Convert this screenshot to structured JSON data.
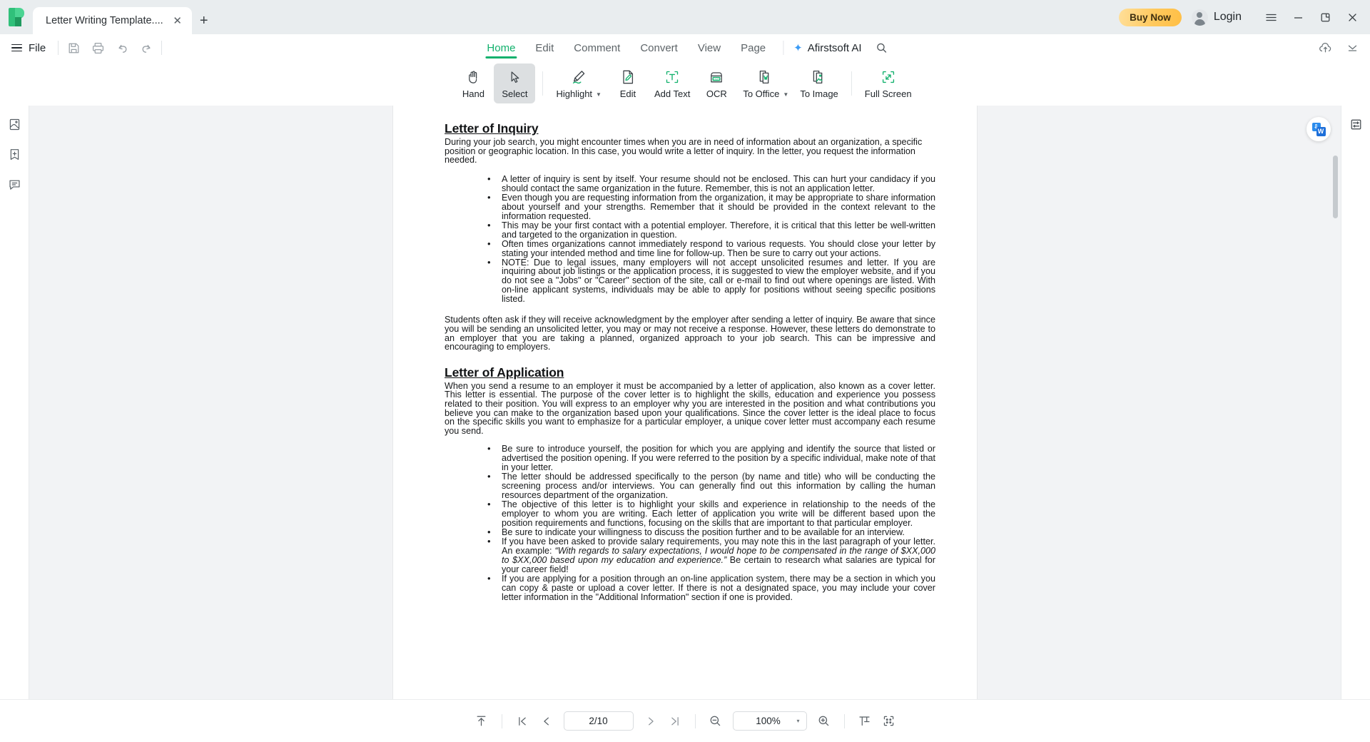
{
  "titlebar": {
    "tab_title": "Letter Writing Template....",
    "close_tab_label": "✕",
    "new_tab_label": "+",
    "buy_now_label": "Buy Now",
    "login_label": "Login",
    "minimize_label": "—",
    "restore_label": "❐",
    "close_label": "✕"
  },
  "menu": {
    "file_label": "File",
    "tabs": [
      {
        "label": "Home",
        "active": true
      },
      {
        "label": "Edit",
        "active": false
      },
      {
        "label": "Comment",
        "active": false
      },
      {
        "label": "Convert",
        "active": false
      },
      {
        "label": "View",
        "active": false
      },
      {
        "label": "Page",
        "active": false
      }
    ],
    "ai_label": "Afirstsoft AI"
  },
  "toolbar": {
    "tools": [
      {
        "label": "Hand",
        "icon": "hand-icon",
        "selected": false,
        "caret": false
      },
      {
        "label": "Select",
        "icon": "cursor-icon",
        "selected": true,
        "caret": false
      },
      {
        "label": "Highlight",
        "icon": "highlight-pen-icon",
        "selected": false,
        "caret": true
      },
      {
        "label": "Edit",
        "icon": "edit-document-icon",
        "selected": false,
        "caret": false
      },
      {
        "label": "Add Text",
        "icon": "add-text-icon",
        "selected": false,
        "caret": false
      },
      {
        "label": "OCR",
        "icon": "ocr-icon",
        "selected": false,
        "caret": false
      },
      {
        "label": "To Office",
        "icon": "to-office-word-icon",
        "selected": false,
        "caret": true
      },
      {
        "label": "To Image",
        "icon": "to-image-icon",
        "selected": false,
        "caret": false
      },
      {
        "label": "Full Screen",
        "icon": "full-screen-icon",
        "selected": false,
        "caret": false
      }
    ]
  },
  "bottombar": {
    "page_value": "2/10",
    "zoom_value": "100%",
    "zoom_caret": "▾"
  },
  "document": {
    "section1_title": "Letter of Inquiry",
    "section1_intro": "During your job search, you might encounter times when you are in need of information about an organization, a specific position or geographic location.  In this case, you would write a letter of inquiry.  In the letter, you request the information needed.",
    "section1_bullets": [
      "A letter of inquiry is sent by itself.  Your resume should not be enclosed.  This can hurt your candidacy if you should contact the same organization in the future. Remember, this is not an application letter.",
      "Even though you are requesting information from the organization, it may be appropriate to share information about yourself and your strengths.  Remember that it should be provided in the context relevant to the information requested.",
      "This may be your first contact with a potential employer.  Therefore, it is critical that this letter be well-written and targeted to the organization in question.",
      "Often times organizations cannot immediately respond to various requests.  You should close your letter by stating your intended method and time line for follow-up.  Then be sure to carry out your actions.",
      "NOTE: Due to legal issues, many employers will not accept unsolicited resumes and letter. If you are inquiring about job listings or the application process, it is suggested to view the employer website, and if you do not see a \"Jobs\" or \"Career\" section of the site, call or e-mail to find out where openings are listed. With on-line applicant systems, individuals may be able to apply for positions without seeing specific positions listed."
    ],
    "section1_closing": "Students often ask if they will receive acknowledgment by the employer after sending a letter of inquiry.  Be aware that since you will be sending an unsolicited letter, you may or may not receive a response.  However, these letters do demonstrate to an employer that you are taking a planned, organized approach to your job search.  This can be impressive and encouraging to employers.",
    "section2_title": "Letter of Application",
    "section2_intro": "When you send a resume to an employer it must be accompanied by a letter of application, also known as a cover letter.  This letter is essential.  The purpose of the cover letter is to highlight the skills, education and experience you possess related to their position.  You will express to an employer why you are interested in the position and what contributions you believe you can make to the organization based upon your qualifications. Since the cover letter is the ideal place to focus on the specific skills you want to emphasize for a particular employer, a unique cover letter must accompany each resume you send.",
    "section2_bullets": [
      "Be sure to introduce yourself, the position for which you are applying and identify the source that listed or advertised the position opening.  If you were referred to the position by a specific individual, make note of that in your letter.",
      "The letter should be addressed specifically to the person (by name and title) who will be conducting the screening process and/or interviews.  You can generally find out this information by calling the human resources department of the organization.",
      "The objective of this letter is to highlight your skills and experience in relationship to the needs of the employer to whom you are writing.  Each letter of application you write will be different based upon the position requirements and functions, focusing on the skills that are important to that particular employer.",
      "Be sure to indicate your willingness to discuss the position further and to be available for an interview.",
      "If you are applying for a position through an on-line application system, there may be a section in which you can copy & paste or upload a cover letter.  If there is not a designated space, you may include your cover letter information in the \"Additional Information\" section if one is provided."
    ],
    "salary_bullet_pre": "If you have been asked to provide salary requirements, you may note this in the last paragraph of your letter.  An example: ",
    "salary_bullet_italic": "“With regards to salary expectations, I would hope to be compensated in the range of $XX,000 to $XX,000 based upon my education and experience.”",
    "salary_bullet_post": "  Be certain to research what salaries are typical for your career field!"
  },
  "colors": {
    "accent_green": "#12b16d",
    "buy_now_gold": "#ffc95e",
    "titlebar_bg": "#e9edef",
    "workspace_bg": "#f2f3f5"
  }
}
